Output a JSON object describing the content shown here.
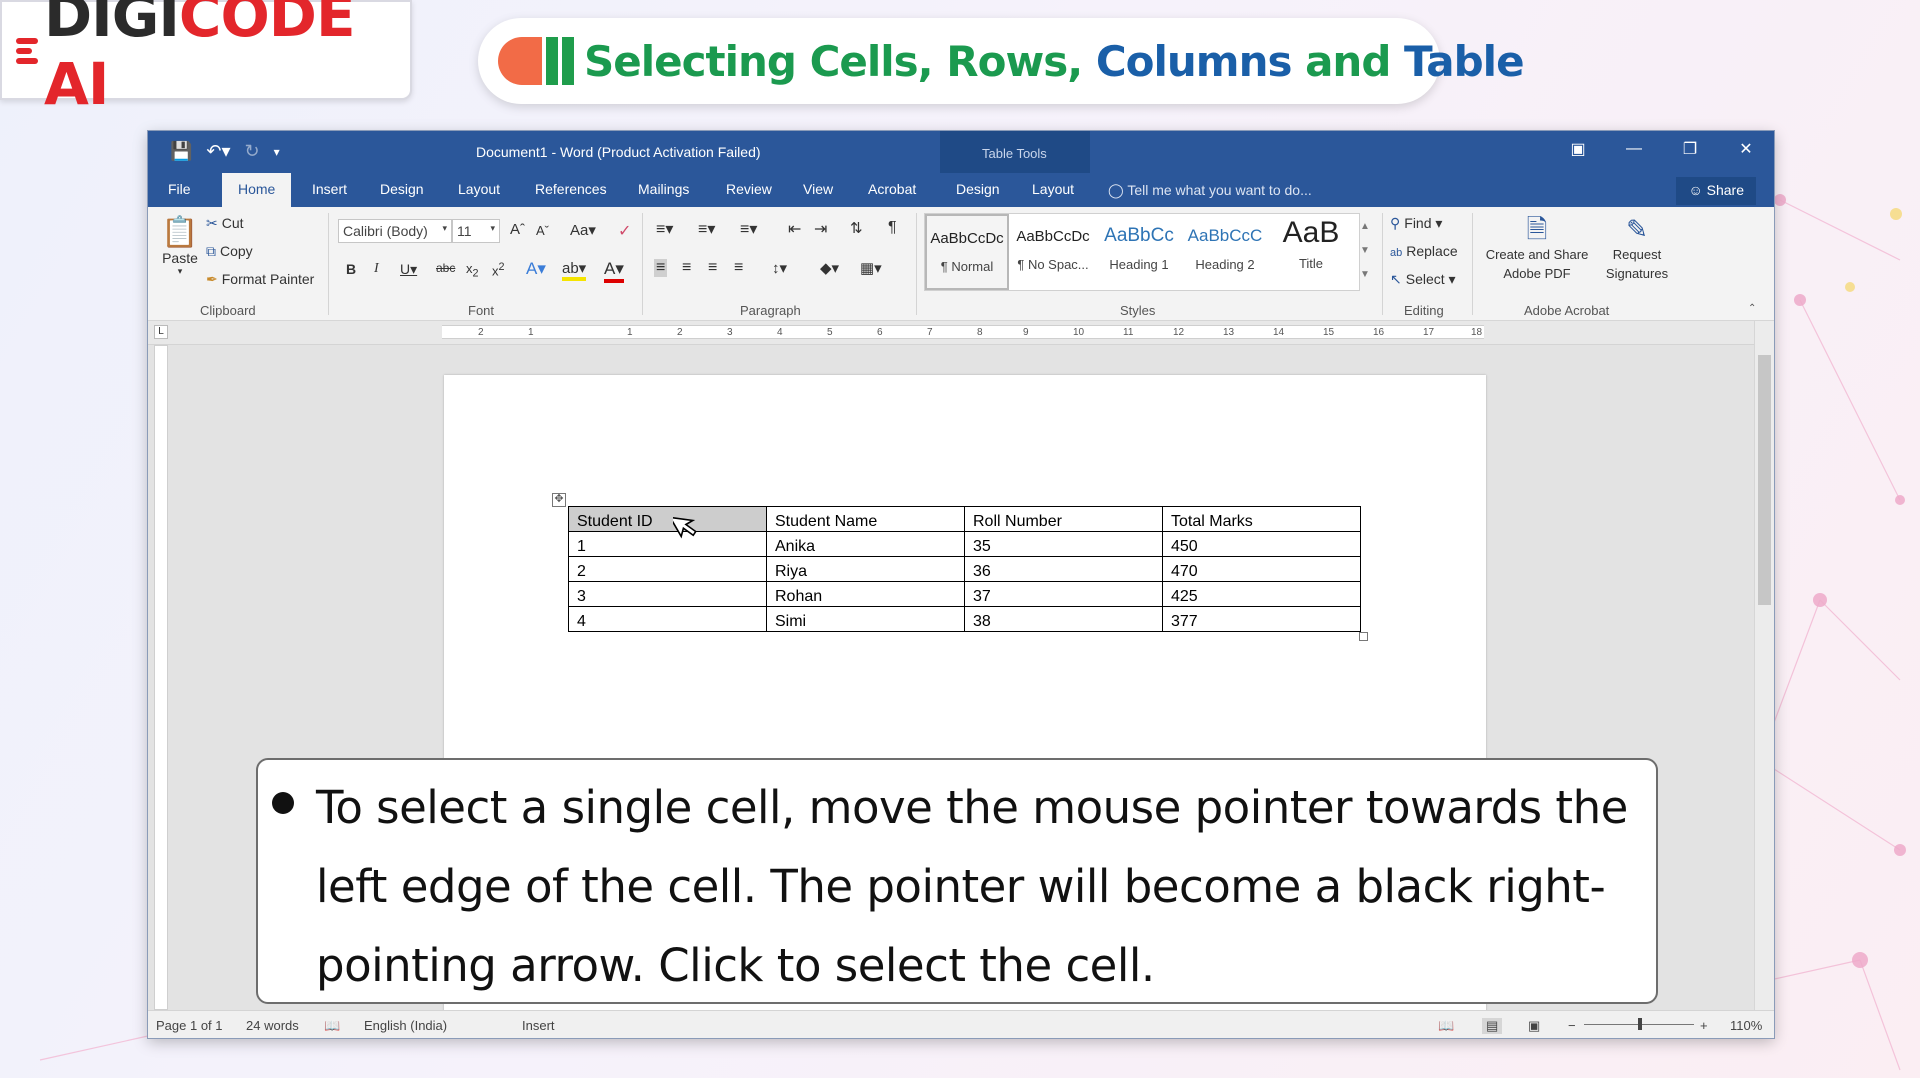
{
  "brand": {
    "name_dark": "DIGI",
    "name_red": "CODE AI"
  },
  "banner": {
    "title_green": "Selecting Cells, Rows, ",
    "title_blue": "Columns",
    "title_green2": " and ",
    "title_blue2": "Table"
  },
  "word": {
    "window_title": "Document1 - Word (Product Activation Failed)",
    "table_tools_label": "Table Tools",
    "tabs": [
      "File",
      "Home",
      "Insert",
      "Design",
      "Layout",
      "References",
      "Mailings",
      "Review",
      "View",
      "Acrobat",
      "Design",
      "Layout"
    ],
    "active_tab": "Home",
    "tell_me": "Tell me what you want to do...",
    "share": "Share",
    "clipboard": {
      "paste": "Paste",
      "cut": "Cut",
      "copy": "Copy",
      "format_painter": "Format Painter",
      "label": "Clipboard"
    },
    "font": {
      "family": "Calibri (Body)",
      "size": "11",
      "label": "Font"
    },
    "paragraph": {
      "label": "Paragraph"
    },
    "styles": {
      "label": "Styles",
      "items": [
        {
          "preview": "AaBbCcDc",
          "name": "¶ Normal"
        },
        {
          "preview": "AaBbCcDc",
          "name": "¶ No Spac..."
        },
        {
          "preview": "AaBbCc",
          "name": "Heading 1"
        },
        {
          "preview": "AaBbCcC",
          "name": "Heading 2"
        },
        {
          "preview": "AaB",
          "name": "Title"
        }
      ]
    },
    "editing": {
      "find": "Find",
      "replace": "Replace",
      "select": "Select",
      "label": "Editing"
    },
    "acrobat": {
      "create": "Create and Share",
      "create2": "Adobe PDF",
      "request": "Request",
      "request2": "Signatures",
      "label": "Adobe Acrobat"
    },
    "ruler_ticks": [
      "2",
      "1",
      "1",
      "2",
      "3",
      "4",
      "5",
      "6",
      "7",
      "8",
      "9",
      "10",
      "11",
      "12",
      "13",
      "14",
      "15",
      "16",
      "17",
      "18"
    ],
    "table": {
      "headers": [
        "Student ID",
        "Student Name",
        "Roll Number",
        "Total Marks"
      ],
      "rows": [
        [
          "1",
          "Anika",
          "35",
          "450"
        ],
        [
          "2",
          "Riya",
          "36",
          "470"
        ],
        [
          "3",
          "Rohan",
          "37",
          "425"
        ],
        [
          "4",
          "Simi",
          "38",
          "377"
        ]
      ]
    },
    "status": {
      "page": "Page 1 of 1",
      "words": "24 words",
      "language": "English (India)",
      "mode": "Insert",
      "zoom": "110%"
    }
  },
  "callout": {
    "text": "To select a single cell, move the mouse pointer towards the left edge of the cell. The pointer will become a black right-pointing arrow. Click to select the cell."
  },
  "colors": {
    "word_blue": "#2b579a",
    "brand_red": "#e3262b",
    "title_green": "#1b9a4f",
    "title_blue": "#1a5fa8"
  }
}
